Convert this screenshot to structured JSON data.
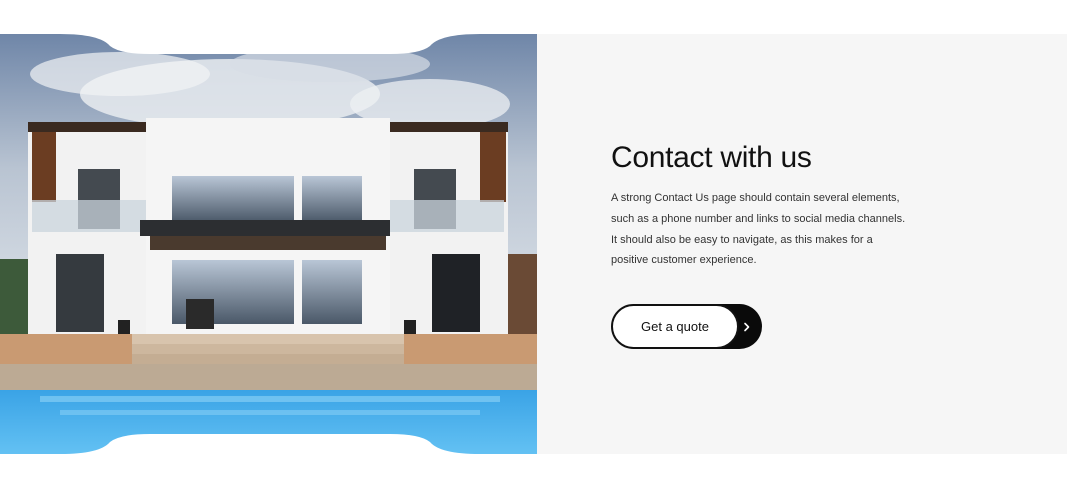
{
  "contact": {
    "title": "Contact with us",
    "body_lines": [
      "A strong Contact Us page should contain several elements,",
      "such as a phone number and links to social media channels.",
      "It should also be easy to navigate, as this makes for a",
      "positive customer experience."
    ],
    "cta_label": "Get a quote",
    "cta_icon": "chevron-right-icon"
  },
  "colors": {
    "section_bg": "#f6f6f6",
    "text": "#111111",
    "button_border": "#111111",
    "arrow_bg": "#0a0a0a"
  }
}
